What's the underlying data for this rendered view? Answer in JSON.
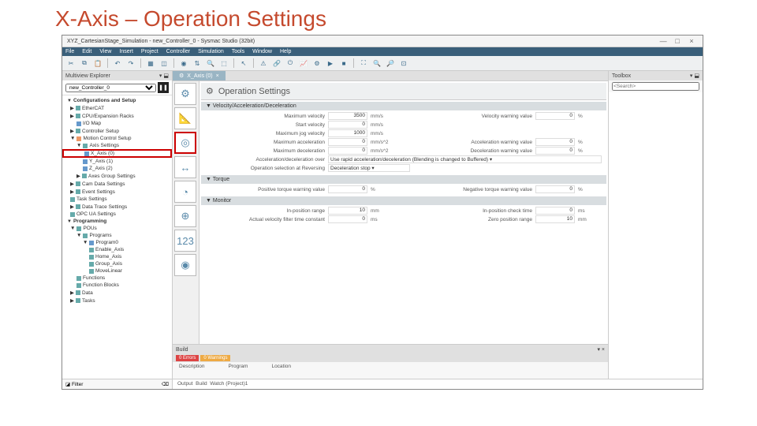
{
  "slide_title": "X-Axis – Operation Settings",
  "window_title": "XYZ_CartesianStage_Simulation - new_Controller_0 - Sysmac Studio (32bit)",
  "menu": [
    "File",
    "Edit",
    "View",
    "Insert",
    "Project",
    "Controller",
    "Simulation",
    "Tools",
    "Window",
    "Help"
  ],
  "explorer": {
    "title": "Multiview Explorer",
    "controller": "new_Controller_0",
    "groups": {
      "config": "Configurations and Setup",
      "prog": "Programming"
    },
    "items": {
      "ethercat": "EtherCAT",
      "cpu": "CPU/Expansion Racks",
      "iomap": "I/O Map",
      "ctrlsetup": "Controller Setup",
      "motion": "Motion Control Setup",
      "axis": "Axis Settings",
      "x": "X_Axis (0)",
      "y": "Y_Axis (1)",
      "z": "Z_Axis (2)",
      "axgrp": "Axes Group Settings",
      "cam": "Cam Data Settings",
      "event": "Event Settings",
      "task": "Task Settings",
      "trace": "Data Trace Settings",
      "opcua": "OPC UA Settings",
      "pous": "POUs",
      "programs": "Programs",
      "program0": "Program0",
      "enable": "Enable_Axis",
      "home": "Home_Axis",
      "group": "Group_Axis",
      "movelin": "MoveLinear",
      "functions": "Functions",
      "fblocks": "Function Blocks",
      "data": "Data",
      "tasks": "Tasks"
    }
  },
  "tab": {
    "label": "X_Axis (0)"
  },
  "page_title": "Operation Settings",
  "velaccel": {
    "head": "▼ Velocity/Acceleration/Deceleration",
    "rows": {
      "maxvel_l": "Maximum velocity",
      "maxvel_v": "3500",
      "maxvel_u": "mm/s",
      "velwarn_l": "Velocity warning value",
      "velwarn_v": "0",
      "velwarn_u": "%",
      "startvel_l": "Start velocity",
      "startvel_v": "0",
      "startvel_u": "mm/s",
      "maxjog_l": "Maximum jog velocity",
      "maxjog_v": "1000",
      "maxjog_u": "mm/s",
      "maxacc_l": "Maximum acceleration",
      "maxacc_v": "0",
      "maxacc_u": "mm/s^2",
      "accwarn_l": "Acceleration warning value",
      "accwarn_v": "0",
      "accwarn_u": "%",
      "maxdec_l": "Maximum deceleration",
      "maxdec_v": "0",
      "maxdec_u": "mm/s^2",
      "decwarn_l": "Deceleration warning value",
      "decwarn_v": "0",
      "decwarn_u": "%",
      "adover_l": "Acceleration/deceleration over",
      "adover_v": "Use rapid acceleration/deceleration (Blending is changed to Buffered) ▾",
      "opsel_l": "Operation selection at Reversing",
      "opsel_v": "Deceleration stop ▾"
    }
  },
  "torque": {
    "head": "▼ Torque",
    "pos_l": "Positive torque warning value",
    "pos_v": "0",
    "pos_u": "%",
    "neg_l": "Negative torque warning value",
    "neg_v": "0",
    "neg_u": "%"
  },
  "monitor": {
    "head": "▼ Monitor",
    "ipr_l": "In-position range",
    "ipr_v": "10",
    "ipr_u": "mm",
    "ipc_l": "In-position check time",
    "ipc_v": "0",
    "ipc_u": "ms",
    "avf_l": "Actual velocity filter time constant",
    "avf_v": "0",
    "avf_u": "ms",
    "zpr_l": "Zero position range",
    "zpr_v": "10",
    "zpr_u": "mm"
  },
  "toolbox": {
    "title": "Toolbox",
    "search_ph": "<Search>"
  },
  "build": {
    "title": "Build",
    "tabs": {
      "err": "0 Errors",
      "warn": "0 Warnings"
    },
    "cols": [
      "Description",
      "Program",
      "Location"
    ]
  },
  "filter": "Filter",
  "bottom_tabs": [
    "Output",
    "Build",
    "Watch (Project)1"
  ]
}
